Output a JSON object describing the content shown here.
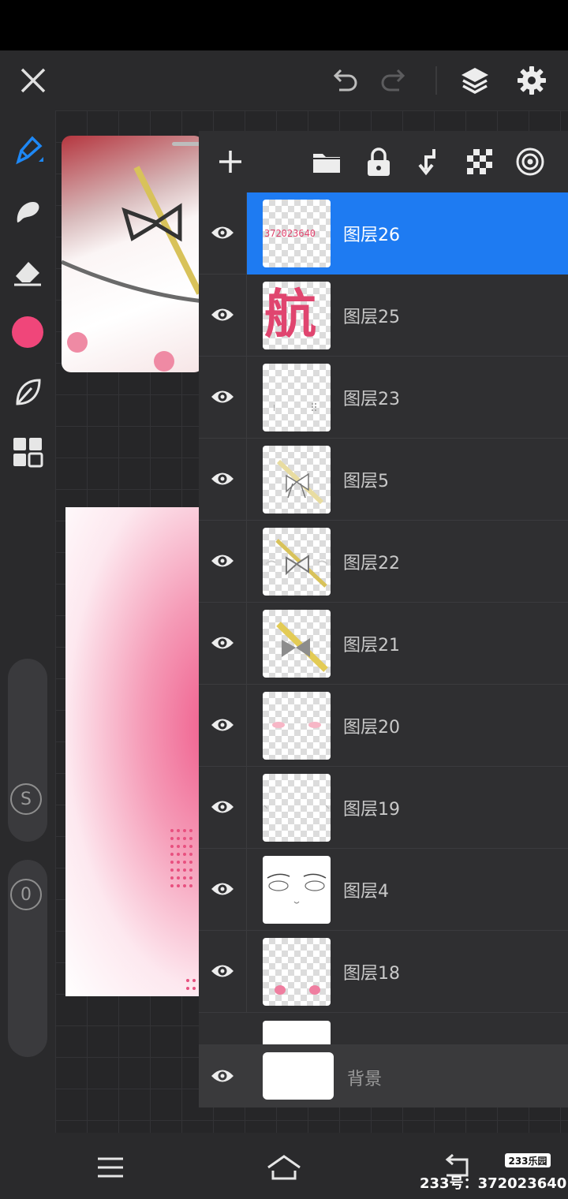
{
  "layers": [
    {
      "name": "图层26",
      "visible": true,
      "selected": true,
      "thumb_text": "372023640"
    },
    {
      "name": "图层25",
      "visible": true,
      "selected": false,
      "thumb_text": "航"
    },
    {
      "name": "图层23",
      "visible": true,
      "selected": false
    },
    {
      "name": "图层5",
      "visible": true,
      "selected": false
    },
    {
      "name": "图层22",
      "visible": true,
      "selected": false
    },
    {
      "name": "图层21",
      "visible": true,
      "selected": false
    },
    {
      "name": "图层20",
      "visible": true,
      "selected": false
    },
    {
      "name": "图层19",
      "visible": true,
      "selected": false
    },
    {
      "name": "图层4",
      "visible": true,
      "selected": false
    },
    {
      "name": "图层18",
      "visible": true,
      "selected": false
    }
  ],
  "background_layer": {
    "name": "背景",
    "visible": true
  },
  "toolbar": {
    "knob_s": "S",
    "knob_0": "0"
  },
  "colors": {
    "accent": "#1e7bf2",
    "current_color": "#f0467a",
    "panel": "#2f2f31"
  },
  "icons": {
    "topbar": [
      "close-icon",
      "undo-icon",
      "redo-icon",
      "layers-icon",
      "settings-icon"
    ],
    "layers_toolbar": [
      "add-layer-icon",
      "folder-icon",
      "lock-icon",
      "merge-down-icon",
      "transparency-icon",
      "target-icon"
    ]
  },
  "watermark": {
    "logo": "233乐园",
    "text": "233号：372023640"
  }
}
